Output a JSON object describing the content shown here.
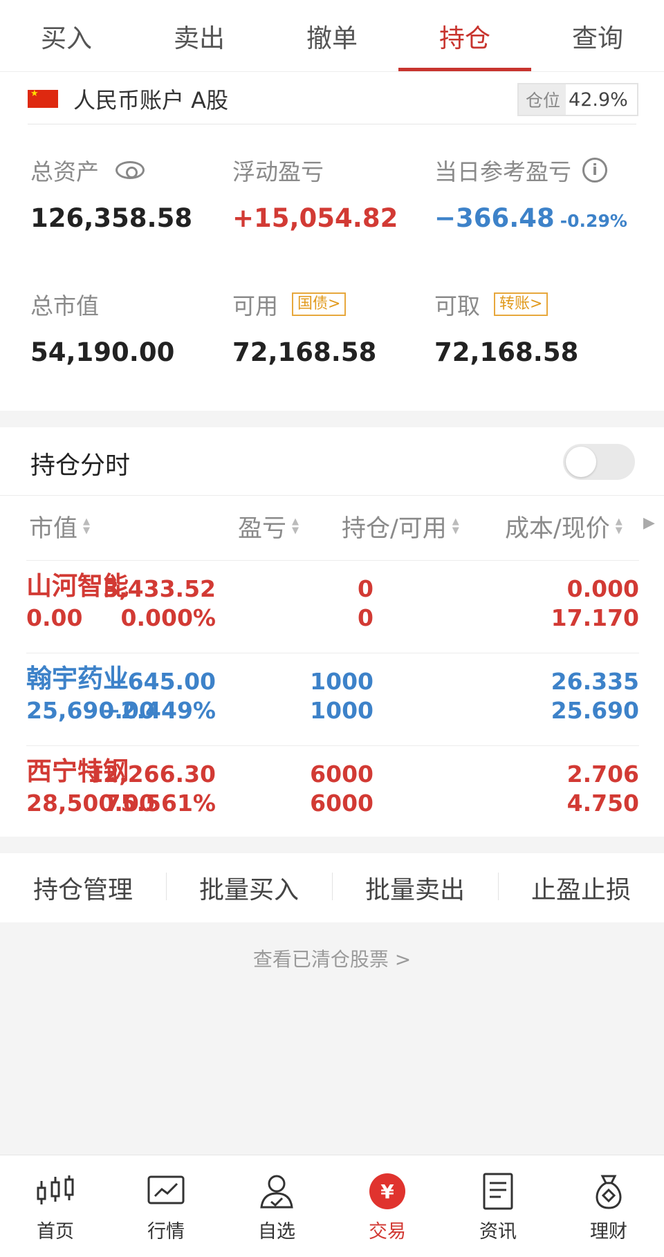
{
  "tabs": [
    {
      "label": "买入"
    },
    {
      "label": "卖出"
    },
    {
      "label": "撤单"
    },
    {
      "label": "持仓",
      "active": true
    },
    {
      "label": "查询"
    }
  ],
  "account": {
    "name": "人民币账户 A股",
    "position_label": "仓位",
    "position_value": "42.9%"
  },
  "summary": {
    "total_assets_label": "总资产",
    "total_assets": "126,358.58",
    "floating_pl_label": "浮动盈亏",
    "floating_pl": "+15,054.82",
    "day_pl_label": "当日参考盈亏",
    "day_pl": "−366.48",
    "day_pl_pct": "-0.29%",
    "market_value_label": "总市值",
    "market_value": "54,190.00",
    "available_label": "可用",
    "available_tag": "国债>",
    "available": "72,168.58",
    "withdrawable_label": "可取",
    "withdrawable_tag": "转账>",
    "withdrawable": "72,168.58"
  },
  "holdings": {
    "title": "持仓分时",
    "toggle_on": false,
    "headers": {
      "market_value": "市值",
      "profit_loss": "盈亏",
      "qty": "持仓/可用",
      "cost_price": "成本/现价"
    },
    "rows": [
      {
        "name": "山河智能",
        "market_value": "0.00",
        "pl": "3,433.52",
        "pl_pct": "0.000%",
        "qty": "0",
        "available": "0",
        "cost": "0.000",
        "price": "17.170",
        "color": "red"
      },
      {
        "name": "翰宇药业",
        "market_value": "25,690.00",
        "pl": "−645.00",
        "pl_pct": "−2.449%",
        "qty": "1000",
        "available": "1000",
        "cost": "26.335",
        "price": "25.690",
        "color": "blue"
      },
      {
        "name": "西宁特钢",
        "market_value": "28,500.00",
        "pl": "12,266.30",
        "pl_pct": "75.561%",
        "qty": "6000",
        "available": "6000",
        "cost": "2.706",
        "price": "4.750",
        "color": "red"
      }
    ]
  },
  "actions": [
    {
      "label": "持仓管理"
    },
    {
      "label": "批量买入"
    },
    {
      "label": "批量卖出"
    },
    {
      "label": "止盈止损"
    }
  ],
  "cleared_link": "查看已清仓股票 >",
  "bottom_nav": [
    {
      "label": "首页",
      "icon": "candlestick-icon"
    },
    {
      "label": "行情",
      "icon": "market-chart-icon"
    },
    {
      "label": "自选",
      "icon": "person-check-icon"
    },
    {
      "label": "交易",
      "icon": "yuan-icon",
      "active": true
    },
    {
      "label": "资讯",
      "icon": "document-icon"
    },
    {
      "label": "理财",
      "icon": "money-bag-icon"
    }
  ],
  "colors": {
    "accent_red": "#d23a34",
    "down_blue": "#3d82c9",
    "tag_orange": "#e19a1d"
  }
}
